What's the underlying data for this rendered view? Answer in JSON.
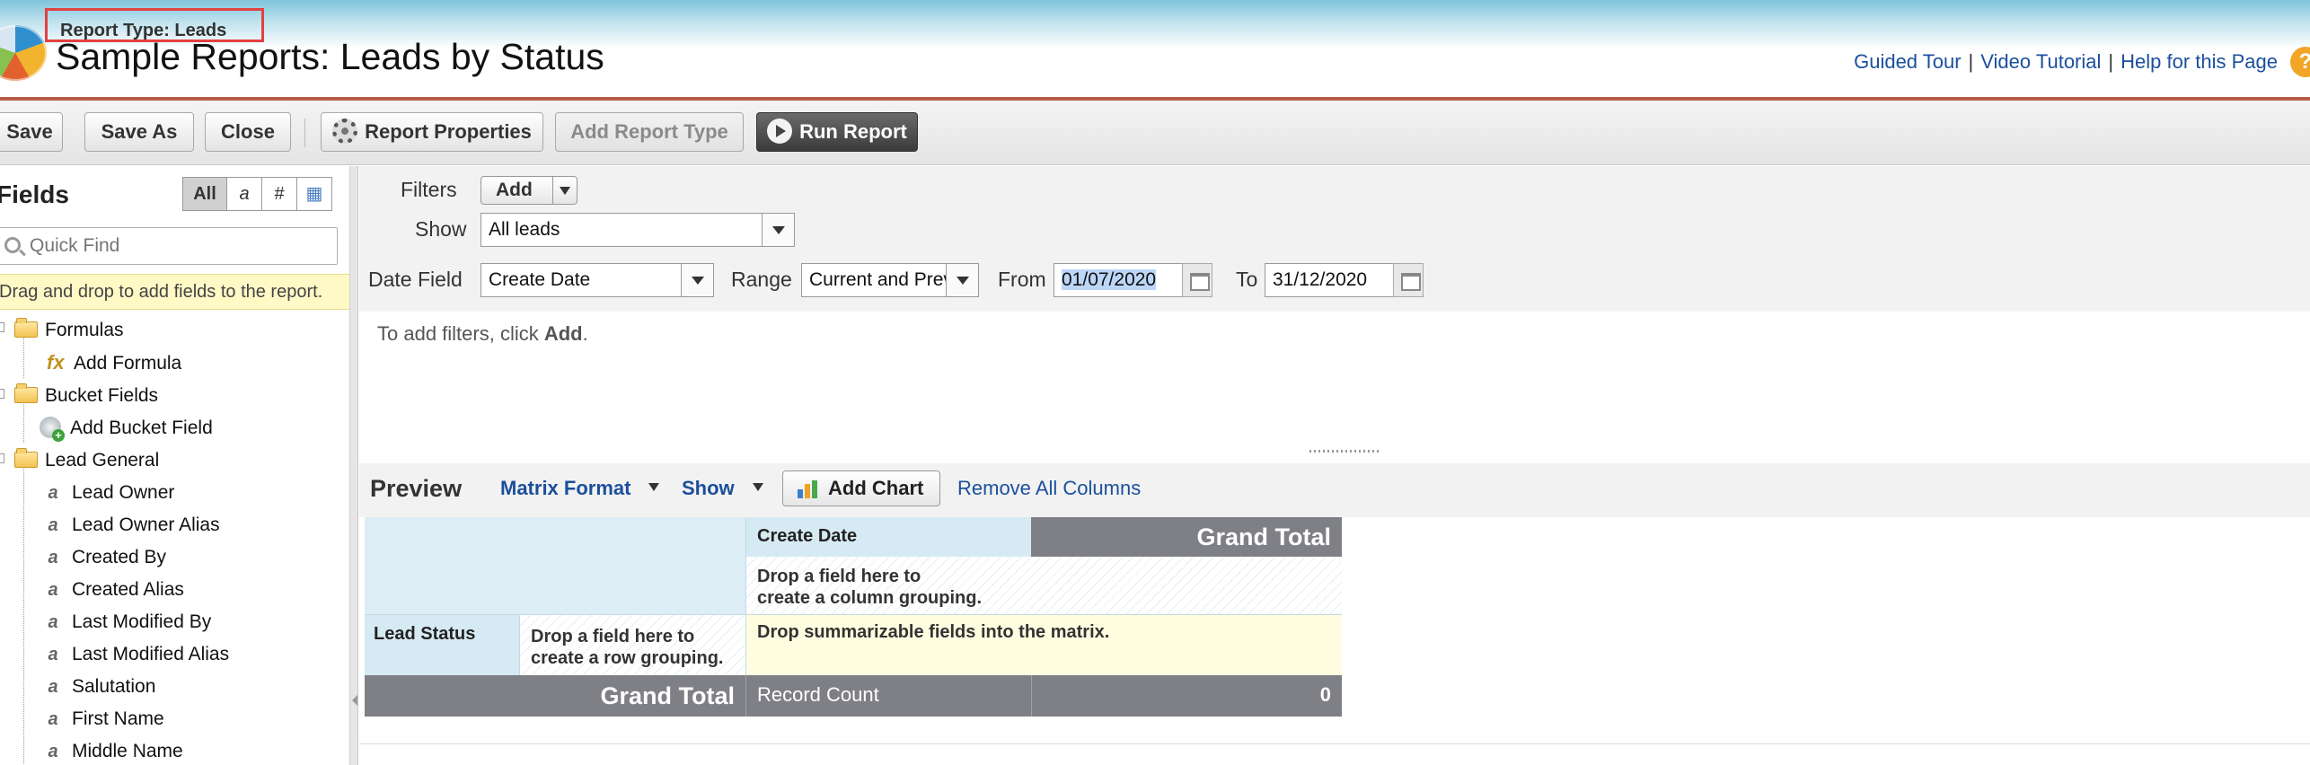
{
  "header": {
    "report_type": "Report Type: Leads",
    "title": "Sample Reports: Leads by Status",
    "links": [
      "Guided Tour",
      "Video Tutorial",
      "Help for this Page"
    ],
    "separator": "|",
    "help_icon": "?"
  },
  "toolbar": {
    "save": "Save",
    "save_as": "Save As",
    "close": "Close",
    "report_properties": "Report Properties",
    "add_report_type": "Add Report Type",
    "run_report": "Run Report"
  },
  "sidebar": {
    "title": "Fields",
    "filter_buttons": [
      "All",
      "a",
      "#",
      "▦"
    ],
    "quick_find_placeholder": "Quick Find",
    "drag_hint": "Drag and drop to add fields to the report.",
    "tree": {
      "formulas": "Formulas",
      "add_formula": "Add Formula",
      "bucket_fields": "Bucket Fields",
      "add_bucket_field": "Add Bucket Field",
      "lead_general": "Lead General",
      "fields": [
        "Lead Owner",
        "Lead Owner Alias",
        "Created By",
        "Created Alias",
        "Last Modified By",
        "Last Modified Alias",
        "Salutation",
        "First Name",
        "Middle Name"
      ]
    }
  },
  "filters": {
    "filters_label": "Filters",
    "add_button": "Add",
    "show_label": "Show",
    "show_value": "All leads",
    "date_field_label": "Date Field",
    "date_field_value": "Create Date",
    "range_label": "Range",
    "range_value": "Current and Previous FY",
    "from_label": "From",
    "from_value": "01/07/2020",
    "to_label": "To",
    "to_value": "31/12/2020",
    "hint_prefix": "To add filters, click ",
    "hint_bold": "Add",
    "hint_suffix": "."
  },
  "preview": {
    "title": "Preview",
    "format": "Matrix Format",
    "show": "Show",
    "add_chart": "Add Chart",
    "remove_columns": "Remove All Columns",
    "matrix": {
      "col_header": "Create Date",
      "grand_total_header": "Grand Total",
      "col_drop_line1": "Drop a field here to",
      "col_drop_line2": "create a column grouping.",
      "row_header": "Lead Status",
      "row_drop_line1": "Drop a field here to",
      "row_drop_line2": "create a row grouping.",
      "summary_drop": "Drop summarizable fields into the matrix.",
      "grand_total_row": "Grand Total",
      "record_count_label": "Record Count",
      "record_count_value": "0"
    }
  },
  "colors": {
    "accent_red": "#e34040",
    "link_blue": "#1b4f9c",
    "header_rule": "#b45c46",
    "matrix_header_blue": "#dcedf5",
    "matrix_dark": "#7f7f86",
    "summary_yellow": "#fffde0"
  }
}
